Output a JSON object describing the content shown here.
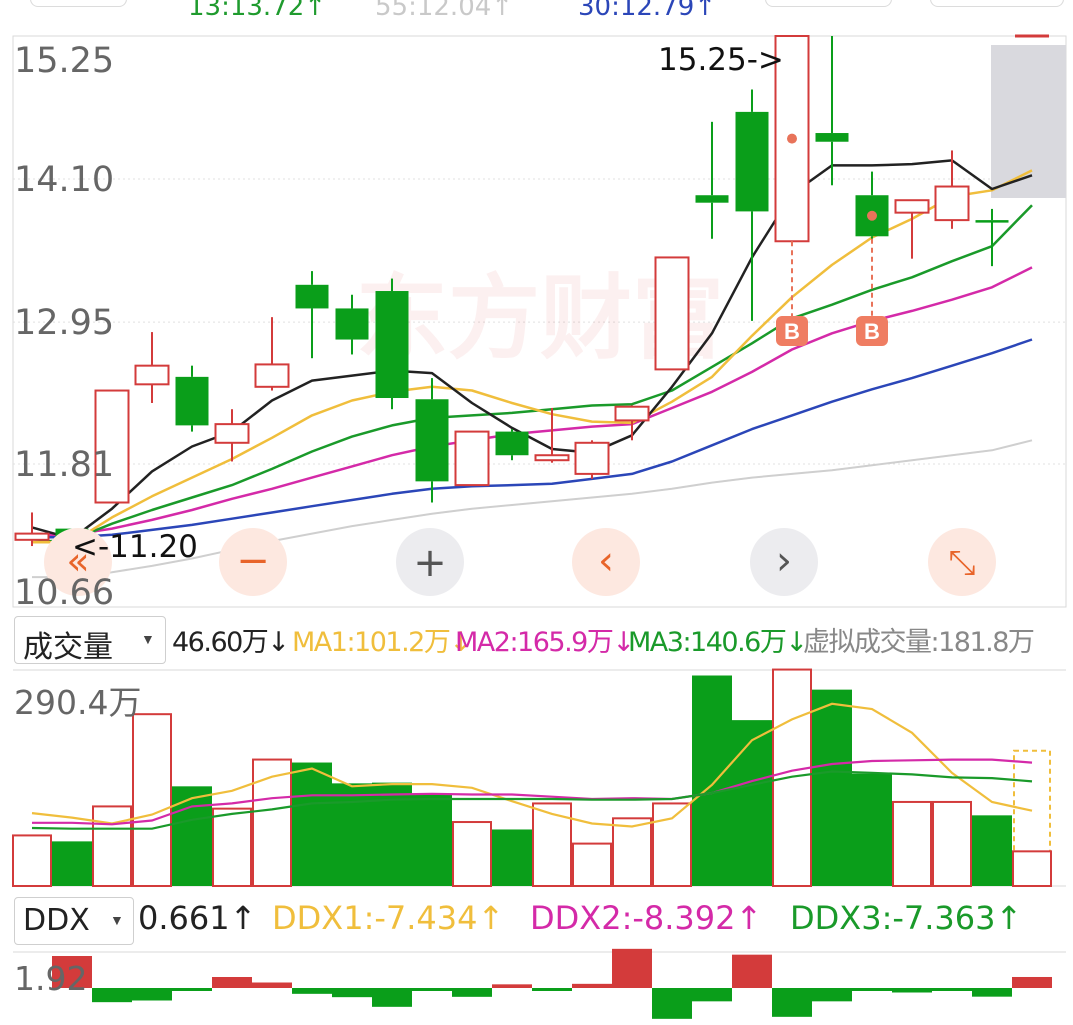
{
  "top_ma": [
    {
      "text": "13:13.72↑",
      "color": "#1f9b2e"
    },
    {
      "text": "55:12.04↑",
      "color": "#c9c9c9"
    },
    {
      "text": "30:12.79↑",
      "color": "#2b46b8"
    }
  ],
  "colors": {
    "up": "#d33b3b",
    "down": "#0a9e1a",
    "ma5": "#222222",
    "ma10": "#f0be3c",
    "ma20": "#1a9a2a",
    "ma30": "#d42aa8",
    "ma60": "#2b46b8",
    "ma120": "#cfcfcf",
    "controls": "#e8642a"
  },
  "chart_data": [
    {
      "type": "candlestick",
      "y_ticks": [
        "15.25",
        "14.10",
        "12.95",
        "11.81",
        "10.66"
      ],
      "ylim": [
        10.66,
        15.25
      ],
      "annotations": {
        "high_label": "15.25->",
        "low_label": "<-11.20"
      },
      "signals": [
        {
          "candle": 19,
          "label": "B"
        },
        {
          "candle": 21,
          "label": "B"
        }
      ],
      "candles": [
        {
          "o": 11.2,
          "c": 11.25,
          "h": 11.42,
          "l": 11.15
        },
        {
          "o": 11.29,
          "c": 11.16,
          "h": 11.29,
          "l": 11.14
        },
        {
          "o": 11.5,
          "c": 12.4,
          "h": 12.4,
          "l": 11.5
        },
        {
          "o": 12.45,
          "c": 12.6,
          "h": 12.87,
          "l": 12.3
        },
        {
          "o": 12.51,
          "c": 12.12,
          "h": 12.6,
          "l": 12.07
        },
        {
          "o": 11.98,
          "c": 12.13,
          "h": 12.25,
          "l": 11.83
        },
        {
          "o": 12.43,
          "c": 12.61,
          "h": 12.99,
          "l": 12.4
        },
        {
          "o": 13.25,
          "c": 13.06,
          "h": 13.36,
          "l": 12.66
        },
        {
          "o": 13.06,
          "c": 12.81,
          "h": 13.17,
          "l": 12.69
        },
        {
          "o": 13.2,
          "c": 12.34,
          "h": 13.3,
          "l": 12.25
        },
        {
          "o": 12.33,
          "c": 11.67,
          "h": 12.5,
          "l": 11.5
        },
        {
          "o": 11.64,
          "c": 12.07,
          "h": 12.07,
          "l": 11.64
        },
        {
          "o": 12.07,
          "c": 11.88,
          "h": 12.09,
          "l": 11.84
        },
        {
          "o": 11.84,
          "c": 11.88,
          "h": 12.26,
          "l": 11.82
        },
        {
          "o": 11.73,
          "c": 11.98,
          "h": 12.0,
          "l": 11.69
        },
        {
          "o": 12.16,
          "c": 12.27,
          "h": 12.28,
          "l": 12.0
        },
        {
          "o": 12.57,
          "c": 13.47,
          "h": 13.47,
          "l": 12.57
        },
        {
          "o": 13.97,
          "c": 13.91,
          "h": 14.56,
          "l": 13.62
        },
        {
          "o": 14.64,
          "c": 13.84,
          "h": 14.82,
          "l": 12.96
        },
        {
          "o": 13.6,
          "c": 15.25,
          "h": 15.25,
          "l": 13.6
        },
        {
          "o": 14.47,
          "c": 14.4,
          "h": 15.25,
          "l": 14.05
        },
        {
          "o": 13.97,
          "c": 13.64,
          "h": 14.16,
          "l": 13.62
        },
        {
          "o": 13.83,
          "c": 13.93,
          "h": 13.93,
          "l": 13.46
        },
        {
          "o": 13.77,
          "c": 14.04,
          "h": 14.33,
          "l": 13.7
        },
        {
          "o": 13.77,
          "c": 13.76,
          "h": 13.86,
          "l": 13.4
        },
        {
          "o": 15.25,
          "c": 15.25,
          "h": 15.25,
          "l": 15.25
        }
      ],
      "ma5": [
        11.3,
        11.21,
        11.45,
        11.75,
        11.95,
        12.07,
        12.32,
        12.48,
        12.52,
        12.56,
        12.54,
        12.3,
        12.1,
        11.93,
        11.9,
        12.04,
        12.43,
        12.86,
        13.47,
        13.98,
        14.21,
        14.21,
        14.22,
        14.25,
        14.02,
        14.13
      ],
      "ma10": [
        11.18,
        11.18,
        11.38,
        11.55,
        11.7,
        11.85,
        12.02,
        12.2,
        12.32,
        12.39,
        12.43,
        12.4,
        12.3,
        12.21,
        12.15,
        12.14,
        12.31,
        12.51,
        12.84,
        13.15,
        13.41,
        13.63,
        13.78,
        13.96,
        14.01,
        14.17
      ],
      "ma20": [
        11.18,
        11.2,
        11.33,
        11.44,
        11.54,
        11.64,
        11.77,
        11.91,
        12.03,
        12.12,
        12.18,
        12.2,
        12.22,
        12.25,
        12.28,
        12.29,
        12.4,
        12.59,
        12.78,
        12.98,
        13.09,
        13.21,
        13.31,
        13.44,
        13.56,
        13.89
      ],
      "ma30": [
        11.24,
        11.24,
        11.29,
        11.36,
        11.44,
        11.53,
        11.61,
        11.7,
        11.79,
        11.88,
        11.95,
        12.0,
        12.05,
        12.08,
        12.11,
        12.13,
        12.26,
        12.39,
        12.55,
        12.73,
        12.86,
        12.96,
        13.04,
        13.13,
        13.23,
        13.39
      ],
      "ma60": [
        11.22,
        11.22,
        11.24,
        11.28,
        11.32,
        11.37,
        11.42,
        11.47,
        11.52,
        11.57,
        11.61,
        11.63,
        11.64,
        11.65,
        11.69,
        11.73,
        11.83,
        11.96,
        12.09,
        12.2,
        12.31,
        12.41,
        12.5,
        12.6,
        12.7,
        12.81
      ],
      "ma120": [
        10.9,
        10.9,
        10.94,
        10.99,
        11.05,
        11.12,
        11.19,
        11.25,
        11.31,
        11.36,
        11.41,
        11.45,
        11.48,
        11.51,
        11.54,
        11.57,
        11.61,
        11.66,
        11.7,
        11.73,
        11.76,
        11.8,
        11.84,
        11.88,
        11.92,
        12.0
      ]
    },
    {
      "type": "bar",
      "indicator_label": "成交量",
      "legend": [
        {
          "text": "46.60万↓",
          "color": "#222222"
        },
        {
          "text": "MA1:101.2万↓",
          "color": "#f0be3c"
        },
        {
          "text": "MA2:165.9万↓",
          "color": "#d42aa8"
        },
        {
          "text": "MA3:140.6万↓",
          "color": "#1a9a2a"
        },
        {
          "text": "虚拟成交量:181.8万",
          "color": "#888888"
        }
      ],
      "y_ticks": [
        "290.4万"
      ],
      "ylim": [
        0,
        290.4
      ],
      "unit": "万",
      "values": [
        68,
        60,
        107,
        231,
        134,
        104,
        170,
        166,
        138,
        139,
        123,
        86,
        76,
        111,
        57,
        91,
        111,
        283,
        223,
        291,
        264,
        151,
        113,
        113,
        95,
        46.6
      ],
      "virtual_volume": 181.8,
      "ma1": [
        98,
        92,
        84,
        96,
        118,
        128,
        147,
        158,
        134,
        137,
        137,
        132,
        114,
        97,
        84,
        80,
        91,
        136,
        196,
        224,
        245,
        238,
        206,
        152,
        113,
        101.2
      ],
      "ma2": [
        85,
        85,
        83,
        88,
        107,
        111,
        118,
        122,
        122,
        123,
        124,
        123,
        123,
        120,
        117,
        118,
        117,
        125,
        141,
        155,
        164,
        168,
        169,
        170,
        170,
        165.9
      ],
      "ma3": [
        78,
        77,
        77,
        77,
        89,
        97,
        103,
        111,
        113,
        116,
        117,
        117,
        117,
        117,
        116,
        116,
        117,
        125,
        136,
        147,
        154,
        152,
        150,
        146,
        145,
        140.6
      ]
    },
    {
      "type": "bar",
      "indicator_label": "DDX",
      "legend": [
        {
          "text": "0.661↑",
          "color": "#222222"
        },
        {
          "text": "DDX1:-7.434↑",
          "color": "#f0be3c"
        },
        {
          "text": "DDX2:-8.392↑",
          "color": "#d42aa8"
        },
        {
          "text": "DDX3:-7.363↑",
          "color": "#1a9a2a"
        }
      ],
      "y_ticks": [
        "1.92"
      ],
      "values": [
        0,
        1.92,
        -0.85,
        -0.75,
        -0.18,
        0.66,
        0.33,
        -0.35,
        -0.55,
        -1.13,
        -0.15,
        -0.53,
        0.22,
        -0.15,
        0.25,
        2.35,
        -1.85,
        -0.8,
        2.0,
        -1.73,
        -0.8,
        -0.15,
        -0.27,
        -0.12,
        -0.52,
        0.661
      ]
    }
  ],
  "controls": [
    {
      "name": "scroll-left-fast-button",
      "glyph": "«"
    },
    {
      "name": "zoom-out-button",
      "glyph": "−"
    },
    {
      "name": "zoom-in-button",
      "glyph": "+"
    },
    {
      "name": "scroll-left-button",
      "glyph": "‹"
    },
    {
      "name": "scroll-right-button",
      "glyph": "›"
    },
    {
      "name": "fullscreen-button",
      "glyph": "⤡"
    }
  ],
  "dropdown_caret": "▼"
}
